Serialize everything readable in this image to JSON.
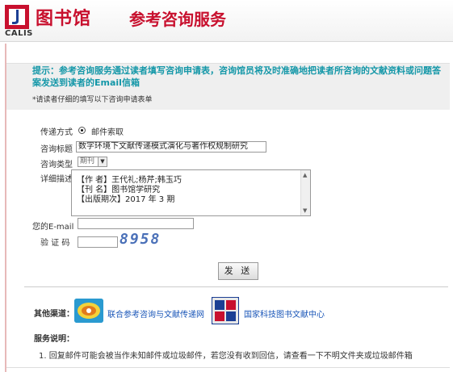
{
  "header": {
    "logo_text": "CALIS",
    "title": "图书馆",
    "subtitle": "参考咨询服务"
  },
  "notice": {
    "text": "提示：参考咨询服务通过读者填写咨询申请表，咨询馆员将及时准确地把读者所咨询的文献资料或问题答案发送到读者的Email信箱",
    "hint": "*请读者仔细的填写以下咨询申请表单"
  },
  "form": {
    "delivery_label": "传递方式",
    "delivery_option": "邮件索取",
    "subject_label": "咨询标题",
    "subject_value": "数字环境下文献传递模式演化与著作权规制研究",
    "type_label": "咨询类型",
    "type_value": "期刊",
    "detail_label": "详细描述",
    "detail_lines": [
      "【作 者】王代礼;杨芹;韩玉巧",
      "【刊 名】图书馆学研究",
      "【出版期次】2017 年 3 期"
    ],
    "email_label": "您的E-mail",
    "email_value": "",
    "captcha_label": "验 证 码",
    "captcha_value": "",
    "captcha_image_text": "8958",
    "send_label": "发 送"
  },
  "other": {
    "label": "其他渠道：",
    "link1": "联合参考咨询与文献传递网",
    "link2": "国家科技图书文献中心",
    "link2_icon_text": "NSTL"
  },
  "service": {
    "title": "服务说明：",
    "item1": "1. 回复邮件可能会被当作未知邮件或垃圾邮件，若您没有收到回信，请查看一下不明文件夹或垃圾邮件箱"
  },
  "colors": {
    "brand_red": "#c8102e",
    "notice_teal": "#1497a8",
    "link_blue": "#1a56b8"
  }
}
